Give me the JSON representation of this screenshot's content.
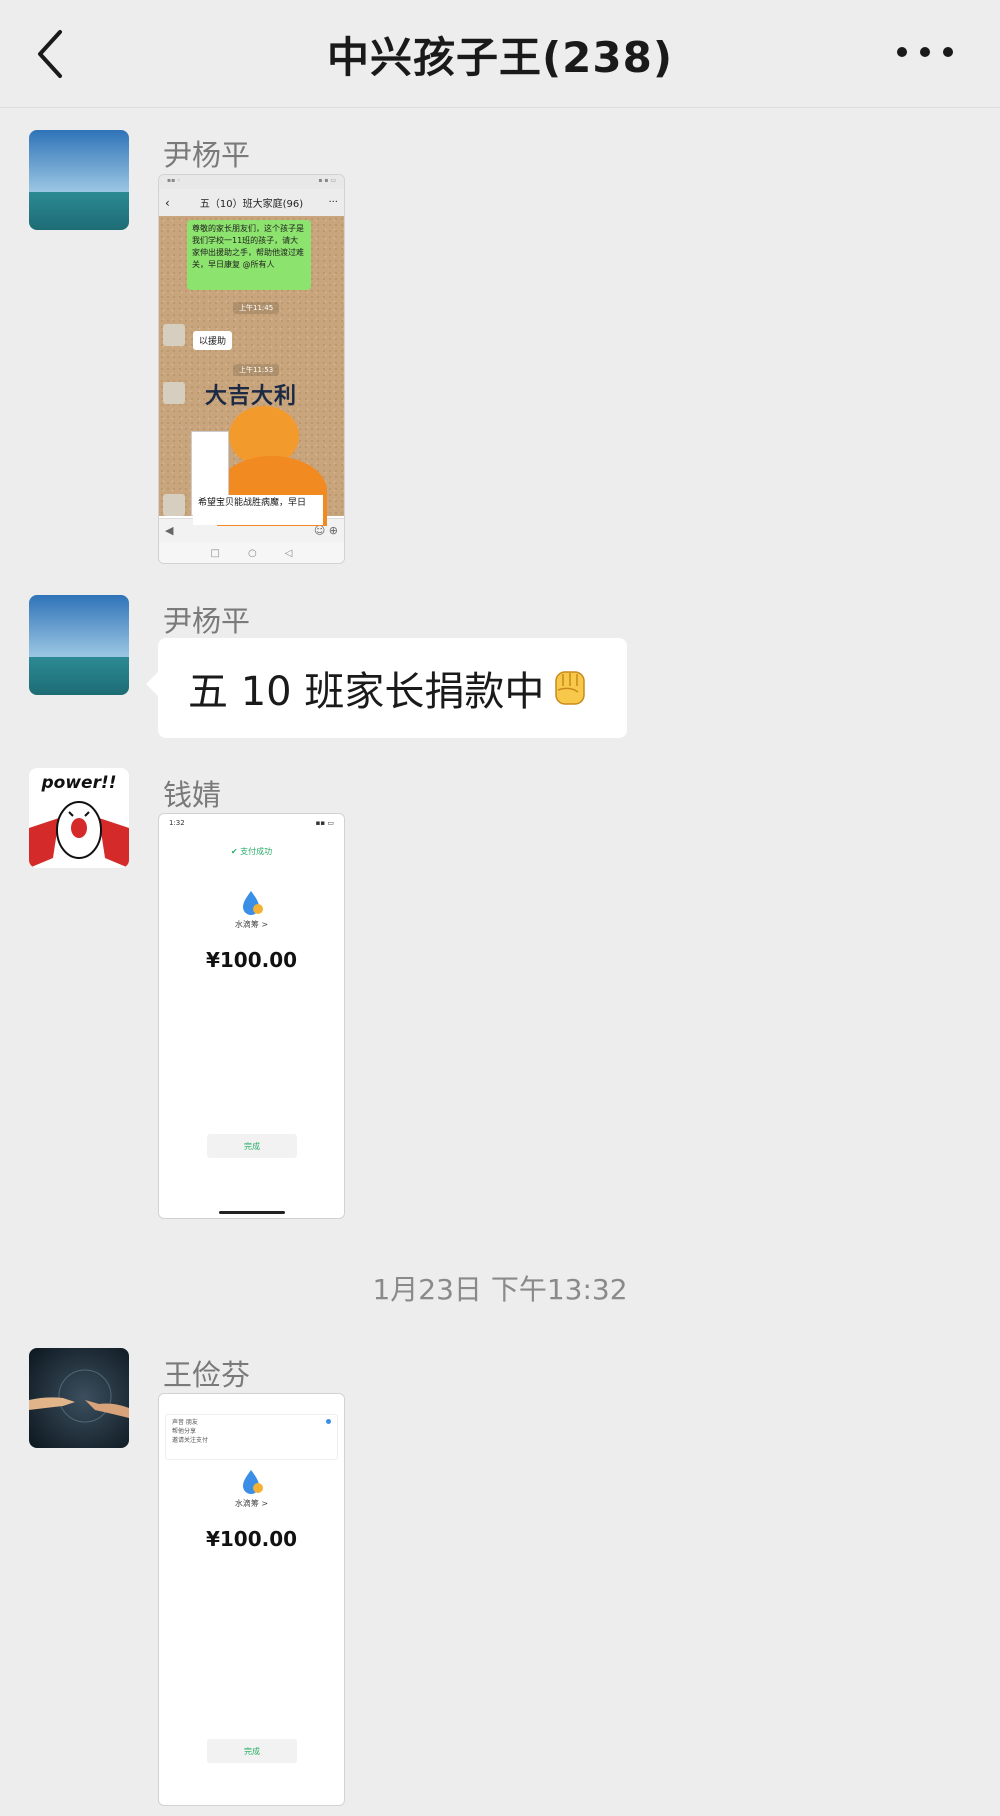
{
  "header": {
    "title": "中兴孩子王(238)",
    "back_icon": "chevron-left-icon",
    "more_icon": "more-icon"
  },
  "messages": [
    {
      "sender": "尹杨平",
      "type": "image",
      "screenshot": {
        "chat_title": "五（10）班大家庭(96)",
        "green_bubble": "尊敬的家长朋友们，这个孩子是我们学校一11班的孩子，请大家伸出援助之手，帮助他渡过难关，早日康复 @所有人",
        "time1": "上午11:45",
        "white_bubble": "以援助",
        "time2": "上午11:53",
        "sticker_text": "大吉大利",
        "bubble2": "希望宝贝能战胜病魔，早日"
      }
    },
    {
      "sender": "尹杨平",
      "type": "text",
      "text": "五 10 班家长捐款中",
      "emoji": "fist-emoji"
    },
    {
      "sender": "钱婧",
      "type": "image",
      "payment": {
        "time": "1:32",
        "status": "支付成功",
        "payee": "水滴筹 >",
        "amount": "¥100.00",
        "done": "完成"
      }
    },
    {
      "sender": "王俭芬",
      "type": "image",
      "payment": {
        "card_line1": "声音 朋友",
        "card_line2": "帮他分享",
        "card_line3": "邀请关注支付",
        "payee": "水滴筹 >",
        "amount": "¥100.00",
        "done": "完成"
      }
    }
  ],
  "timestamp": "1月23日 下午13:32",
  "colors": {
    "background": "#ededed",
    "bubble": "#ffffff",
    "wechat_green": "#2aae67",
    "green_bubble": "#8ce36d"
  }
}
